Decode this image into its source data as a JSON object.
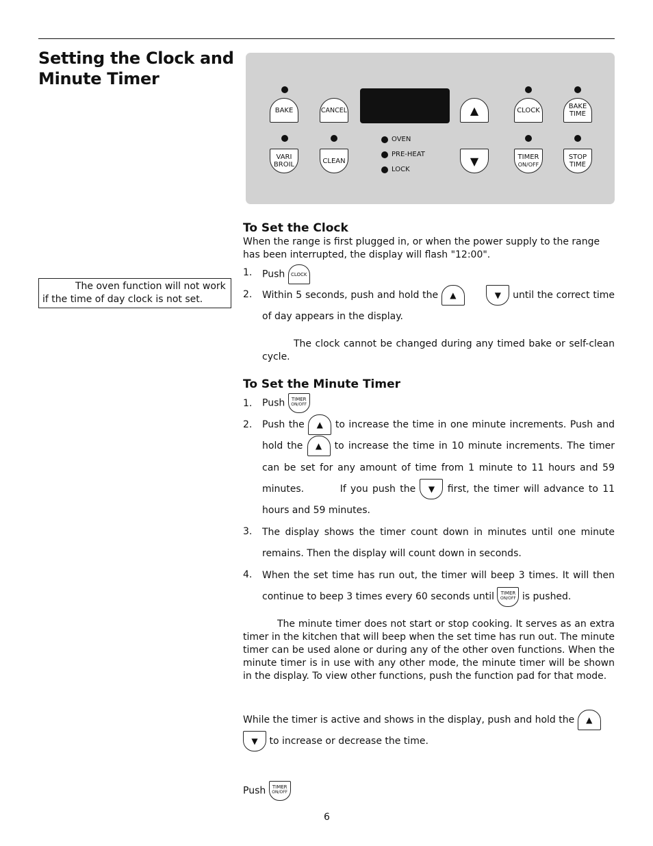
{
  "page": {
    "title_line1": "Setting the Clock and",
    "title_line2": "Minute Timer",
    "page_number": "6"
  },
  "note_box": {
    "text1": "The oven function will not work",
    "text2": "if the time of day clock is not set."
  },
  "panel": {
    "keys": {
      "bake": "BAKE",
      "cancel": "CANCEL",
      "vari_broil_1": "VARI",
      "vari_broil_2": "BROIL",
      "clean": "CLEAN",
      "up": "▲",
      "down": "▼",
      "clock": "CLOCK",
      "bake_time_1": "BAKE",
      "bake_time_2": "TIME",
      "timer_1": "TIMER",
      "timer_2": "ON/OFF",
      "stop_time_1": "STOP",
      "stop_time_2": "TIME"
    },
    "indicators": [
      "OVEN",
      "PRE-HEAT",
      "LOCK"
    ]
  },
  "clock_section": {
    "heading": "To Set the Clock",
    "intro": "When the range is first plugged in, or when the power supply to the range has been interrupted, the display will flash \"12:00\".",
    "step1_num": "1.",
    "step1_text": "Push",
    "step2_num": "2.",
    "step2_a": "Within 5 seconds, push and hold the",
    "step2_b": "until the correct time of day appears in the display.",
    "note": "The clock cannot be changed during any timed bake or self-clean cycle."
  },
  "timer_section": {
    "heading": "To Set the Minute Timer",
    "step1_num": "1.",
    "step1_text": "Push",
    "step2_num": "2.",
    "step2_a": "Push the",
    "step2_b": "to increase the time in one minute increments.  Push and hold the",
    "step2_c": "to increase the time in 10 minute increments. The timer can be set for any amount of time from 1 minute to 11 hours and 59 minutes.",
    "step2_d": "If you push the",
    "step2_e": "first, the timer will advance to 11 hours and 59 minutes.",
    "step3_num": "3.",
    "step3_text": "The display shows the timer count down in minutes until one minute remains. Then the display will count down in seconds.",
    "step4_num": "4.",
    "step4_a": "When the set time has run out, the timer will beep 3 times. It will then continue to beep 3 times every 60 seconds until",
    "step4_b": "is pushed.",
    "note": "The minute timer does not start or stop cooking. It serves as an extra timer in the kitchen that will beep when the set time has run out. The minute timer can be used alone or during any of the other oven functions. When the minute timer is in use with any other mode, the minute timer will be shown in the display. To view other functions, push the function pad for that mode."
  },
  "change_section": {
    "text_a": "While the timer is active and shows in the display, push and hold the",
    "text_b": "to increase or decrease the time."
  },
  "cancel_section": {
    "text": "Push"
  },
  "icon_labels": {
    "clock": "CLOCK",
    "timer_1": "TIMER",
    "timer_2": "ON/OFF",
    "up": "▲",
    "down": "▼"
  }
}
